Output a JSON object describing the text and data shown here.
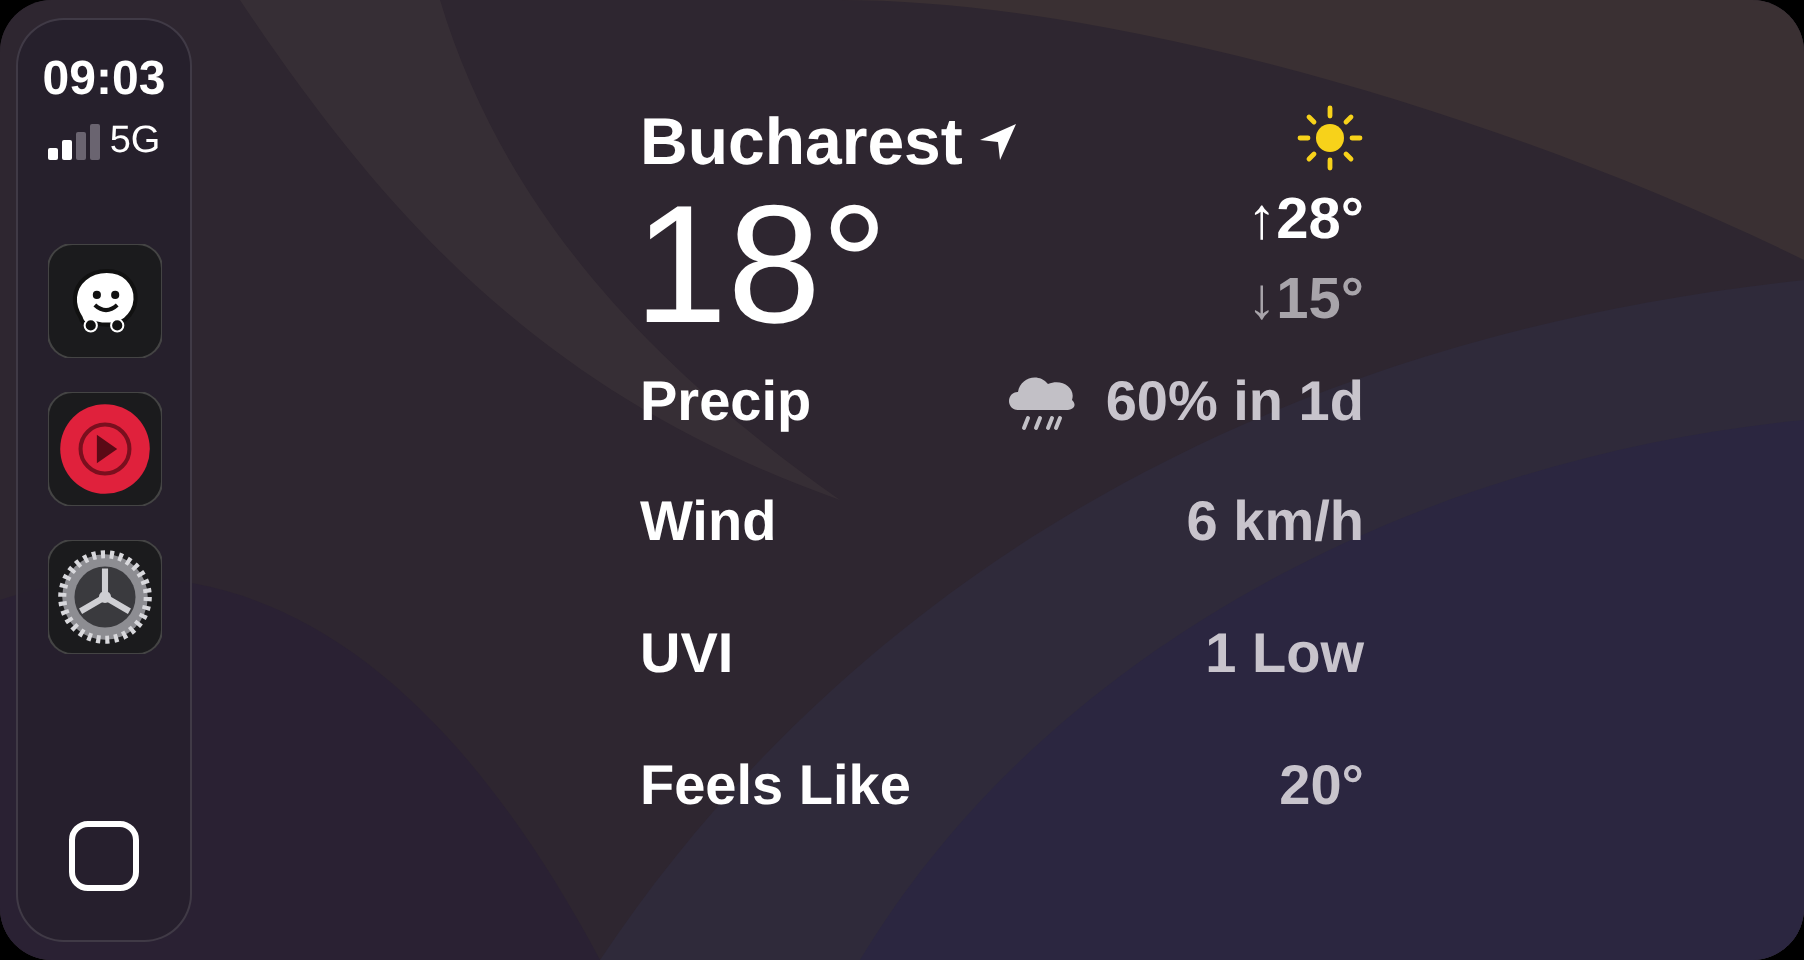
{
  "status": {
    "time": "09:03",
    "network": "5G"
  },
  "apps": [
    {
      "kind": "navigation"
    },
    {
      "kind": "music"
    },
    {
      "kind": "settings"
    }
  ],
  "weather": {
    "city": "Bucharest",
    "temperature": "18°",
    "high": "↑28°",
    "low": "↓15°",
    "details": [
      {
        "kind": "with-icon",
        "label": "Precip",
        "value": "60% in 1d"
      },
      {
        "kind": "plain",
        "label": "Wind",
        "value": "6 km/h"
      },
      {
        "kind": "plain",
        "label": "UVI",
        "value": "1 Low"
      },
      {
        "kind": "plain",
        "label": "Feels Like",
        "value": "20°"
      }
    ]
  }
}
